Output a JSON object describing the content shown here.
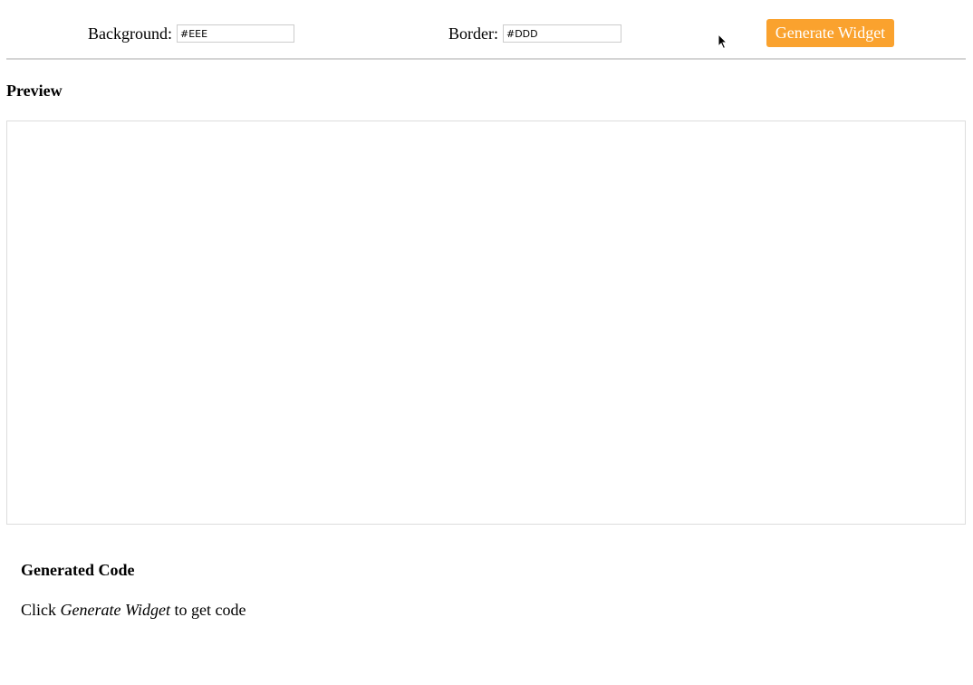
{
  "toolbar": {
    "background_label": "Background:",
    "background_value": "#EEE",
    "border_label": "Border:",
    "border_value": "#DDD",
    "generate_label": "Generate Widget"
  },
  "preview": {
    "heading": "Preview"
  },
  "generated_code": {
    "heading": "Generated Code",
    "hint_prefix": "Click ",
    "hint_emphasis": "Generate Widget",
    "hint_suffix": " to get code"
  },
  "colors": {
    "accent": "#FAA22E",
    "divider": "#D4D4D4",
    "frame_border": "#DDDDDD",
    "input_border": "#CCCCCC"
  },
  "icons": {
    "cursor": "mouse-pointer-icon"
  }
}
